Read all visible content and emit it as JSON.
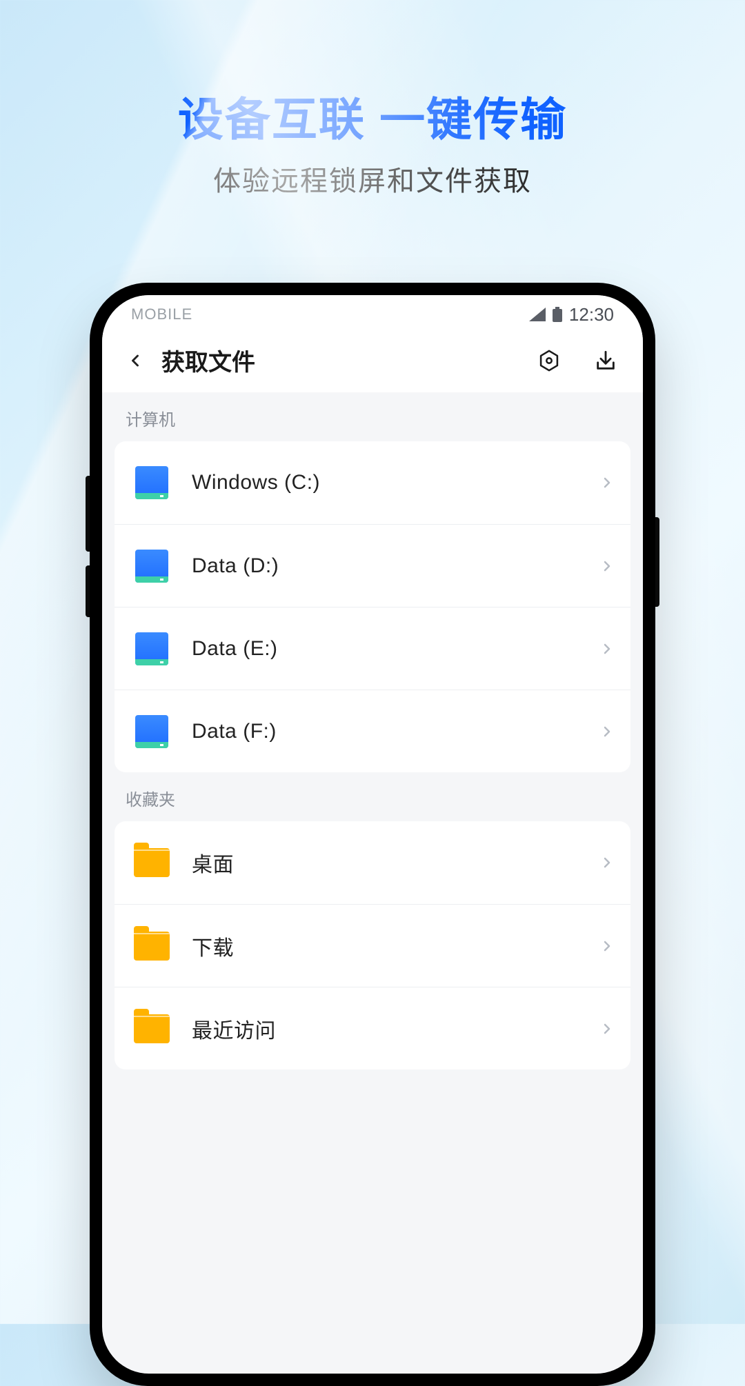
{
  "hero": {
    "title": "设备互联 一键传输",
    "subtitle": "体验远程锁屏和文件获取"
  },
  "status": {
    "carrier": "MOBILE",
    "time": "12:30"
  },
  "app": {
    "title": "获取文件"
  },
  "sections": {
    "computer": {
      "label": "计算机",
      "drives": [
        {
          "name": "Windows (C:)"
        },
        {
          "name": "Data (D:)"
        },
        {
          "name": "Data (E:)"
        },
        {
          "name": "Data (F:)"
        }
      ]
    },
    "favorites": {
      "label": "收藏夹",
      "folders": [
        {
          "name": "桌面"
        },
        {
          "name": "下载"
        },
        {
          "name": "最近访问"
        }
      ]
    }
  }
}
